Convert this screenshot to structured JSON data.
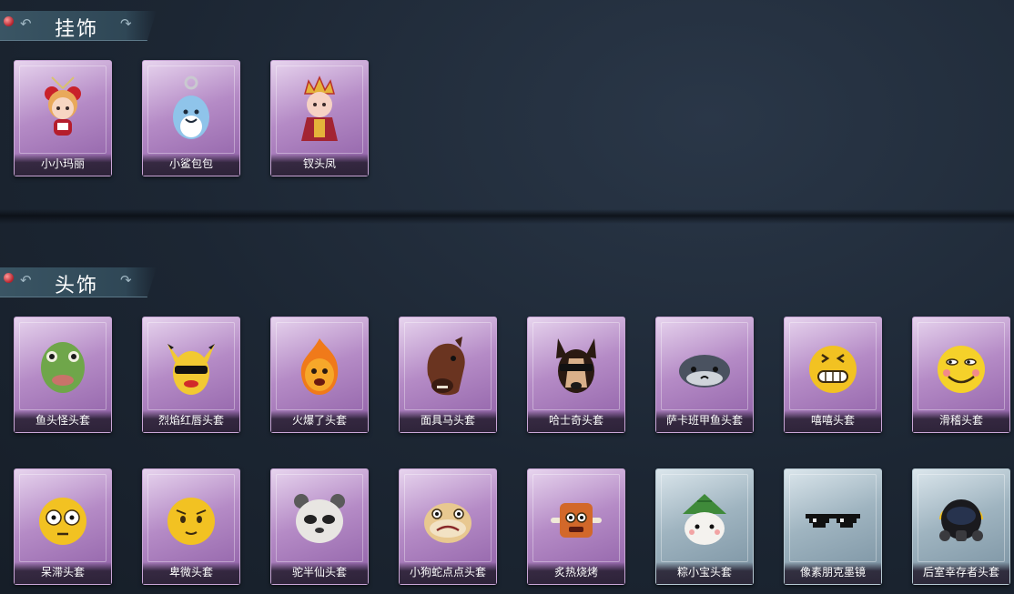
{
  "sections": [
    {
      "title": "挂饰"
    },
    {
      "title": "头饰"
    }
  ],
  "pendants": [
    {
      "label": "小小玛丽",
      "icon": "doll-mary-icon"
    },
    {
      "label": "小鲨包包",
      "icon": "shark-bag-icon"
    },
    {
      "label": "钗头凤",
      "icon": "phoenix-crown-doll-icon"
    }
  ],
  "headwear_row1": [
    {
      "label": "鱼头怪头套",
      "icon": "fish-head-mask-icon"
    },
    {
      "label": "烈焰红唇头套",
      "icon": "yellow-mouse-mask-icon"
    },
    {
      "label": "火爆了头套",
      "icon": "fire-mask-icon"
    },
    {
      "label": "面具马头套",
      "icon": "horse-mask-icon"
    },
    {
      "label": "哈士奇头套",
      "icon": "husky-mask-icon"
    },
    {
      "label": "萨卡班甲鱼头套",
      "icon": "sacabambaspis-mask-icon"
    },
    {
      "label": "嘻嘻头套",
      "icon": "grin-emoji-mask-icon"
    },
    {
      "label": "滑稽头套",
      "icon": "funny-emoji-mask-icon"
    }
  ],
  "headwear_row2": [
    {
      "label": "呆滞头套",
      "icon": "dazed-emoji-mask-icon"
    },
    {
      "label": "卑微头套",
      "icon": "humble-emoji-mask-icon"
    },
    {
      "label": "驼半仙头套",
      "icon": "panda-mask-icon"
    },
    {
      "label": "小狗蛇点点头套",
      "icon": "snake-mask-icon"
    },
    {
      "label": "炙热烧烤",
      "icon": "bbq-mask-icon"
    },
    {
      "label": "粽小宝头套",
      "icon": "zongzi-mask-icon"
    },
    {
      "label": "像素朋克墨镜",
      "icon": "pixel-sunglasses-icon"
    },
    {
      "label": "后室幸存者头套",
      "icon": "gas-mask-helmet-icon"
    }
  ],
  "colors": {
    "rarity_purple": "#b58bc6",
    "rarity_blue": "#9fb4c0",
    "background": "#1c2633"
  }
}
